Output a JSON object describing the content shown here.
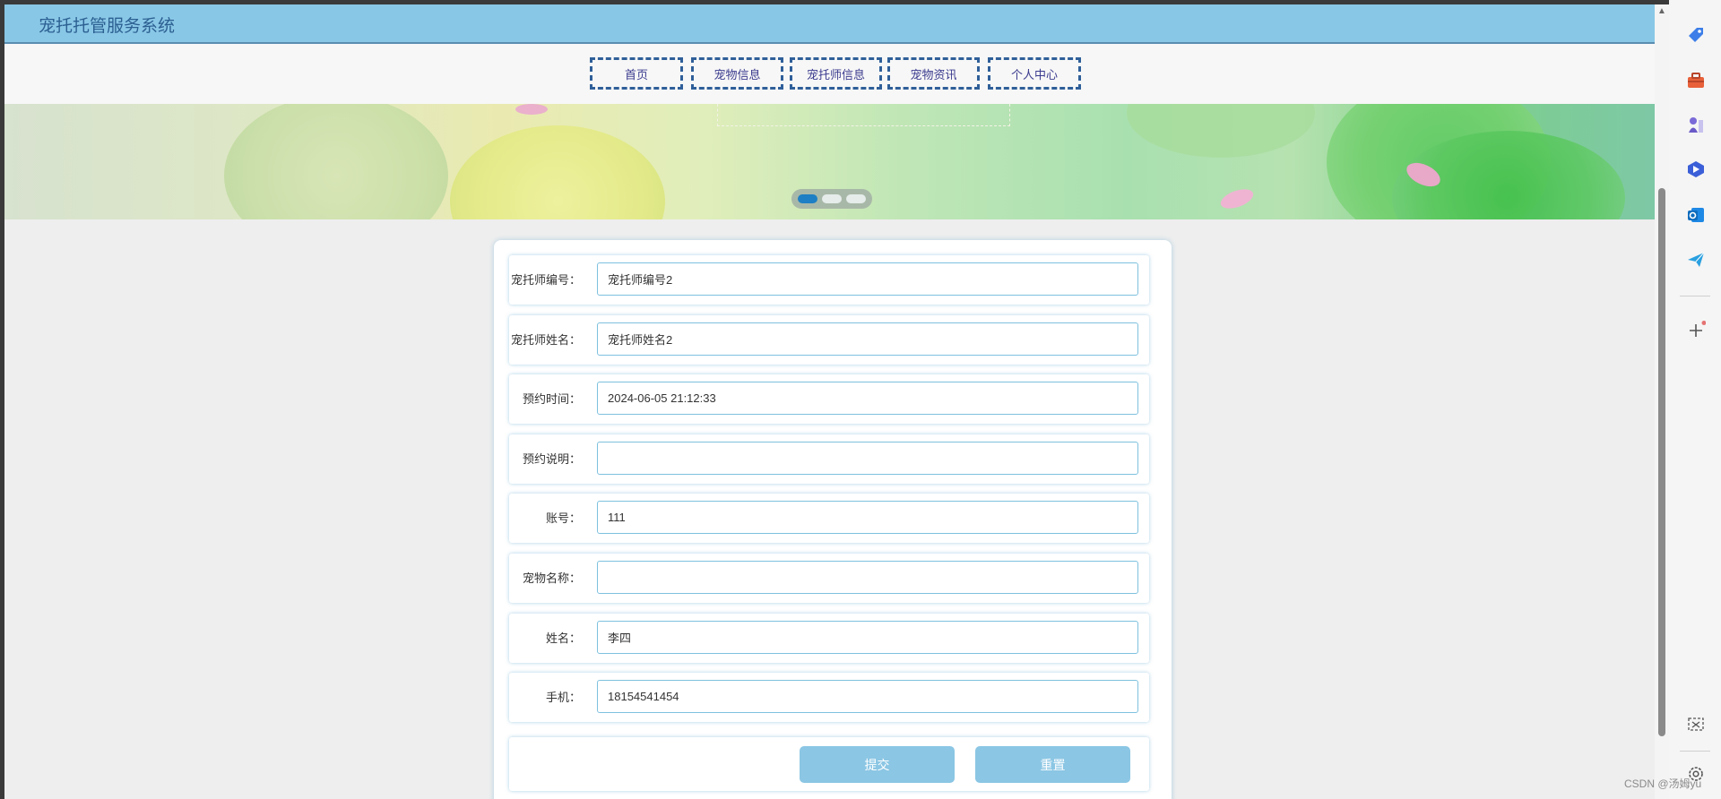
{
  "site": {
    "title": "宠托托管服务系统"
  },
  "nav": {
    "items": [
      {
        "label": "首页"
      },
      {
        "label": "宠物信息"
      },
      {
        "label": "宠托师信息"
      },
      {
        "label": "宠物资讯"
      },
      {
        "label": "个人中心"
      }
    ]
  },
  "banner": {
    "active_slide": 1,
    "slide_count": 3
  },
  "form": {
    "fields": [
      {
        "label": "宠托师编号：",
        "value": "宠托师编号2",
        "placeholder": ""
      },
      {
        "label": "宠托师姓名：",
        "value": "宠托师姓名2",
        "placeholder": ""
      },
      {
        "label": "预约时间：",
        "value": "2024-06-05 21:12:33",
        "placeholder": ""
      },
      {
        "label": "预约说明：",
        "value": "",
        "placeholder": ""
      },
      {
        "label": "账号：",
        "value": "111",
        "placeholder": ""
      },
      {
        "label": "宠物名称：",
        "value": "",
        "placeholder": ""
      },
      {
        "label": "姓名：",
        "value": "李四",
        "placeholder": ""
      },
      {
        "label": "手机：",
        "value": "18154541454",
        "placeholder": ""
      }
    ],
    "submit_label": "提交",
    "reset_label": "重置"
  },
  "watermark": "CSDN @汤姆yu",
  "colors": {
    "header": "#89c7e6",
    "title_text": "#2b5f91",
    "nav_border": "#2f5f99",
    "input_border": "#7ec1de",
    "button": "#8bc6e4",
    "active_dot": "#1e7fc4"
  },
  "sidebar_icons": [
    "tag-icon",
    "toolbox-icon",
    "chess-icon",
    "copilot-icon",
    "outlook-icon",
    "send-icon",
    "add-icon",
    "screenshot-icon",
    "settings-icon"
  ]
}
